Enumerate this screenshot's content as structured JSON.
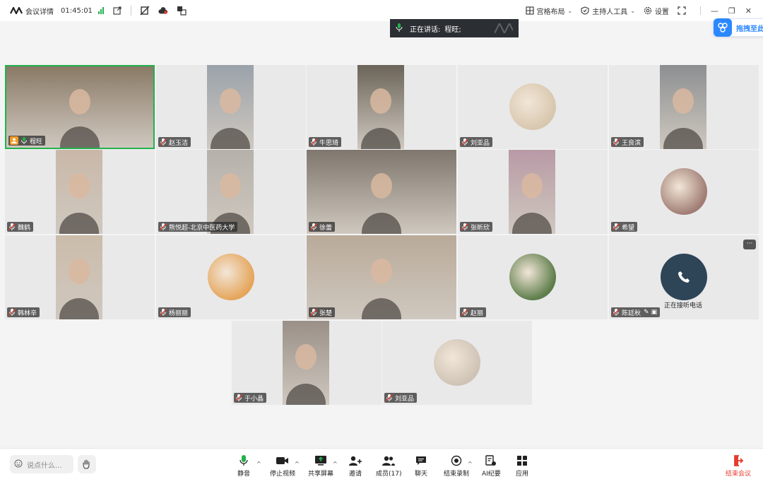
{
  "topbar": {
    "meeting_label": "会议详情",
    "timer": "01:45:01",
    "layout_label": "宫格布局",
    "host_tools_label": "主持人工具",
    "settings_label": "设置"
  },
  "speaking": {
    "prefix": "正在讲话:",
    "name": "程旺;"
  },
  "drag_pill": {
    "label": "拖拽至此"
  },
  "tiles": [
    {
      "name": "程旺",
      "kind": "video",
      "bg": "#8a7a66"
    },
    {
      "name": "赵玉洁",
      "kind": "video",
      "bg": "#9aa2aa"
    },
    {
      "name": "牛思琦",
      "kind": "video",
      "bg": "#6b6458"
    },
    {
      "name": "刘亚品",
      "kind": "avatar",
      "bg": "#d8c7ae"
    },
    {
      "name": "王良滨",
      "kind": "video",
      "bg": "#8c8f91"
    },
    {
      "name": "魏鹤",
      "kind": "video",
      "bg": "#c9b8a8"
    },
    {
      "name": "熊悦超-北京中医药大学",
      "kind": "video",
      "bg": "#b5b1aa"
    },
    {
      "name": "徐蕾",
      "kind": "video",
      "bg": "#7f776d"
    },
    {
      "name": "张昕欣",
      "kind": "video",
      "bg": "#b89aa6"
    },
    {
      "name": "希望",
      "kind": "avatar",
      "bg": "#a07d74"
    },
    {
      "name": "韩林辛",
      "kind": "video",
      "bg": "#cbbcaa"
    },
    {
      "name": "杨丽丽",
      "kind": "avatar",
      "bg": "#e5a55a"
    },
    {
      "name": "张楚",
      "kind": "video",
      "bg": "#b9aa99"
    },
    {
      "name": "赵丽",
      "kind": "avatar",
      "bg": "#5d7d4a"
    },
    {
      "name": "陈廷秋",
      "kind": "phone",
      "bg": "#e9e9ea"
    },
    {
      "name": "于小晶",
      "kind": "video",
      "bg": "#9a9088"
    },
    {
      "name": "刘亚品",
      "kind": "avatar",
      "bg": "#cfc3b5"
    }
  ],
  "phone_status": "正在接听电话",
  "bottombar": {
    "chat_placeholder": "说点什么...",
    "mute": "静音",
    "stop_video": "停止视频",
    "share_screen": "共享屏幕",
    "invite": "邀请",
    "members": "成员(17)",
    "chat": "聊天",
    "end_recording": "结束录制",
    "ai_notes": "AI纪要",
    "apps": "应用",
    "end_meeting": "结束会议"
  },
  "colors": {
    "accent_green": "#22b14c",
    "end_red": "#e63b2e",
    "link_blue": "#2b88ff"
  }
}
